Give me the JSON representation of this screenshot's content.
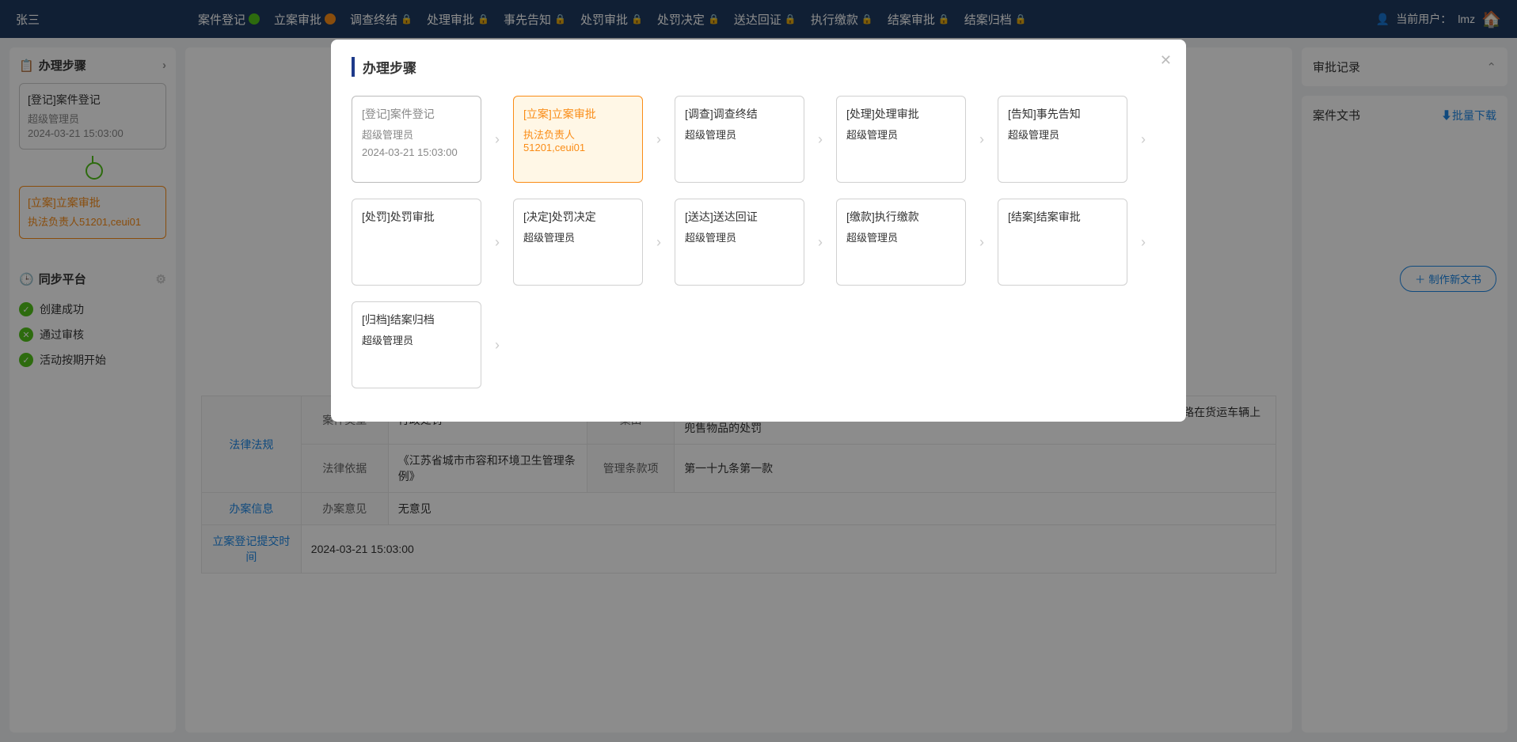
{
  "header": {
    "userLeft": "张三",
    "currentUserLabel": "当前用户：",
    "currentUser": "lmz",
    "tabs": [
      {
        "label": "案件登记",
        "indicator": "green"
      },
      {
        "label": "立案审批",
        "indicator": "orange"
      },
      {
        "label": "调查终结",
        "indicator": "lock"
      },
      {
        "label": "处理审批",
        "indicator": "lock"
      },
      {
        "label": "事先告知",
        "indicator": "lock"
      },
      {
        "label": "处罚审批",
        "indicator": "lock"
      },
      {
        "label": "处罚决定",
        "indicator": "lock"
      },
      {
        "label": "送达回证",
        "indicator": "lock"
      },
      {
        "label": "执行缴款",
        "indicator": "lock"
      },
      {
        "label": "结案审批",
        "indicator": "lock"
      },
      {
        "label": "结案归档",
        "indicator": "lock"
      }
    ]
  },
  "leftPanel": {
    "stepsTitle": "办理步骤",
    "steps": [
      {
        "title": "[登记]案件登记",
        "sub1": "超级管理员",
        "sub2": "2024-03-21 15:03:00",
        "state": "done"
      },
      {
        "title": "[立案]立案审批",
        "sub1": "执法负责人51201,ceui01",
        "sub2": "",
        "state": "current"
      }
    ],
    "syncTitle": "同步平台",
    "syncItems": [
      {
        "label": "创建成功",
        "icon": "green-check"
      },
      {
        "label": "通过审核",
        "icon": "green-x"
      },
      {
        "label": "活动按期开始",
        "icon": "green-check"
      }
    ]
  },
  "center": {
    "rows": {
      "caseTypeLabel": "案件类型",
      "caseType": "行政处罚",
      "causeLabel": "案由",
      "cause": "对擅自占用道路、公共广场、人行过街桥、人行地下通道以及其他公共场地摆摊设点，或者擅自占用道路在货运车辆上兜售物品的处罚",
      "lawBasisLabel": "法律依据",
      "lawBasis": "《江苏省城市市容和环境卫生管理条例》",
      "clauseLabel": "管理条款项",
      "clause": "第一十九条第一款",
      "opinionLabel": "办案意见",
      "opinion": "无意见",
      "submitTimeLabel": "立案登记提交时间",
      "submitTime": "2024-03-21 15:03:00",
      "lawSectionLabel": "法律法规",
      "caseInfoLabel": "办案信息"
    }
  },
  "rightPanel": {
    "approvalTitle": "审批记录",
    "docsTitle": "案件文书",
    "batchDownload": "批量下载",
    "createDoc": "制作新文书"
  },
  "modal": {
    "title": "办理步骤",
    "nodes": [
      {
        "title": "[登记]案件登记",
        "sub": "超级管理员",
        "date": "2024-03-21 15:03:00",
        "state": "done"
      },
      {
        "title": "[立案]立案审批",
        "sub": "执法负责人51201,ceui01",
        "date": "",
        "state": "active"
      },
      {
        "title": "[调查]调查终结",
        "sub": "超级管理员",
        "date": "",
        "state": "pending"
      },
      {
        "title": "[处理]处理审批",
        "sub": "超级管理员",
        "date": "",
        "state": "pending"
      },
      {
        "title": "[告知]事先告知",
        "sub": "超级管理员",
        "date": "",
        "state": "pending"
      },
      {
        "title": "[处罚]处罚审批",
        "sub": "",
        "date": "",
        "state": "pending"
      },
      {
        "title": "[决定]处罚决定",
        "sub": "超级管理员",
        "date": "",
        "state": "pending"
      },
      {
        "title": "[送达]送达回证",
        "sub": "超级管理员",
        "date": "",
        "state": "pending"
      },
      {
        "title": "[缴款]执行缴款",
        "sub": "超级管理员",
        "date": "",
        "state": "pending"
      },
      {
        "title": "[结案]结案审批",
        "sub": "",
        "date": "",
        "state": "pending"
      },
      {
        "title": "[归档]结案归档",
        "sub": "超级管理员",
        "date": "",
        "state": "pending"
      }
    ]
  }
}
